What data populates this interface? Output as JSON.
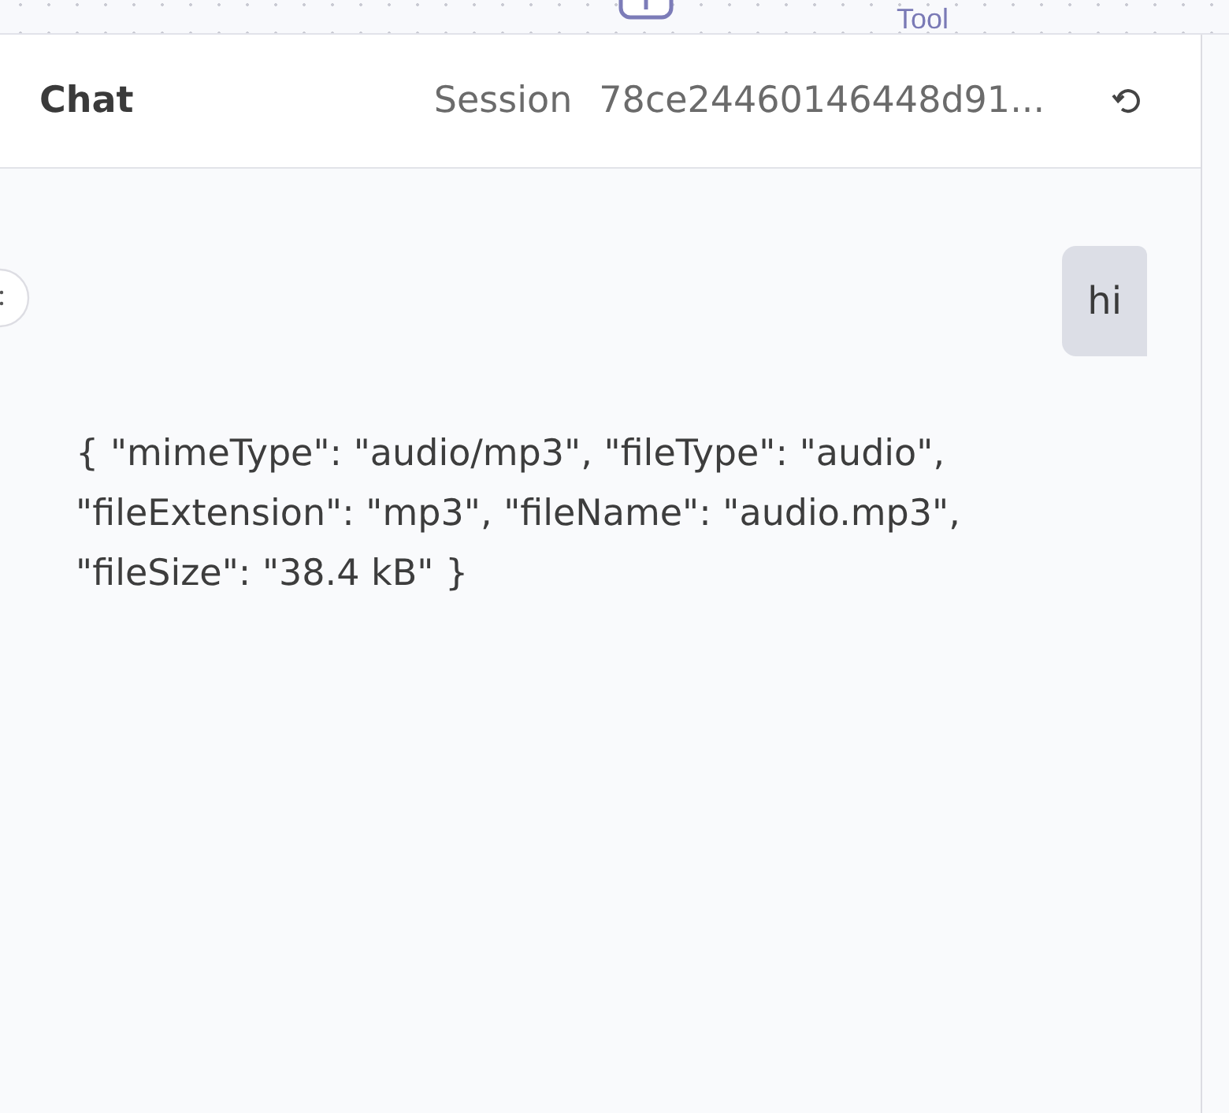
{
  "canvas": {
    "node_label": "Tool"
  },
  "header": {
    "title": "Chat",
    "session_label": "Session",
    "session_id": "78ce24460146448d91..."
  },
  "messages": [
    {
      "kind": "user",
      "text": "hi"
    },
    {
      "kind": "assistant",
      "text": "{ \"mimeType\": \"audio/mp3\", \"fileType\": \"audio\", \"fileExtension\": \"mp3\", \"fileName\": \"audio.mp3\", \"fileSize\": \"38.4 kB\" }"
    }
  ]
}
